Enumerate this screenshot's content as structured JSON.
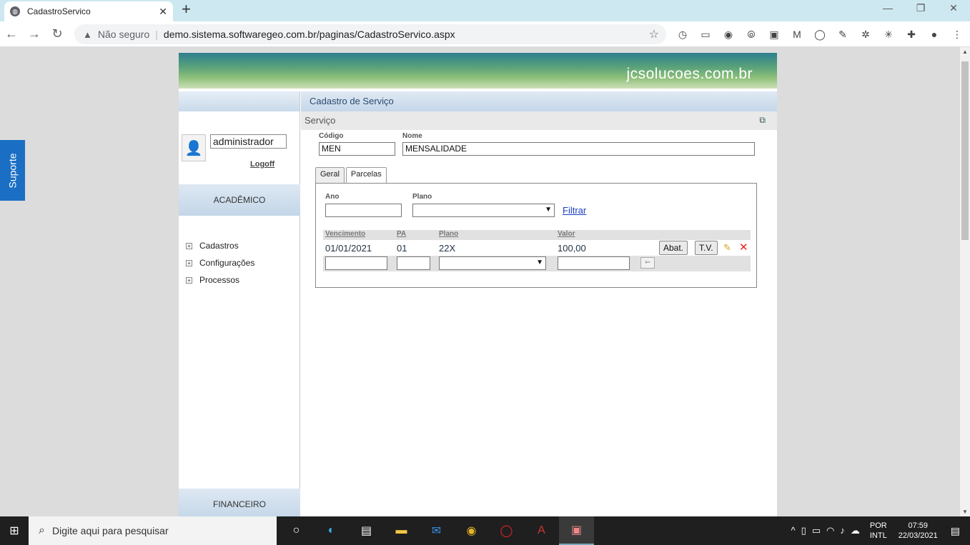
{
  "browser": {
    "tab_title": "CadastroServico",
    "tab_close": "✕",
    "new_tab": "+",
    "window_controls": [
      "—",
      "❐",
      "✕"
    ],
    "nav": {
      "back": "←",
      "forward": "→",
      "reload": "↻"
    },
    "omnibox": {
      "warning_icon": "▲",
      "insecure_label": "Não seguro",
      "url": "demo.sistema.softwaregeo.com.br/paginas/CadastroServico.aspx",
      "star": "☆"
    },
    "extensions": [
      "◷",
      "▭",
      "◉",
      "⦾",
      "▣",
      "M",
      "◯",
      "✎",
      "✲",
      "✳",
      "✚",
      "●",
      "⋮"
    ]
  },
  "suporte": {
    "label": "Suporte"
  },
  "banner": {
    "brand": "jcsolucoes.com.br"
  },
  "sidebar": {
    "username": "administrador",
    "logoff": "Logoff",
    "section_academico": "ACADÊMICO",
    "menu": [
      {
        "label": "Cadastros"
      },
      {
        "label": "Configurações"
      },
      {
        "label": "Processos"
      }
    ],
    "section_financeiro": "FINANCEIRO"
  },
  "content": {
    "title": "Cadastro de Serviço",
    "subheader": "Serviço",
    "codigo_label": "Código",
    "codigo_value": "MEN",
    "nome_label": "Nome",
    "nome_value": "MENSALIDADE",
    "tabs": [
      {
        "label": "Geral"
      },
      {
        "label": "Parcelas"
      }
    ],
    "parcelas": {
      "ano_label": "Ano",
      "ano_value": "",
      "plano_label": "Plano",
      "plano_value": "",
      "filtrar": "Filtrar",
      "headers": {
        "vencimento": "Vencimento",
        "pa": "PA",
        "plano": "Plano",
        "valor": "Valor"
      },
      "rows": [
        {
          "vencimento": "01/01/2021",
          "pa": "01",
          "plano": "22X",
          "valor": "100,00"
        }
      ],
      "abat_button": "Abat.",
      "tv_button": "T.V."
    }
  },
  "taskbar": {
    "search_placeholder": "Digite aqui para pesquisar",
    "lang_top": "POR",
    "lang_bottom": "INTL",
    "time": "07:59",
    "date": "22/03/2021"
  }
}
